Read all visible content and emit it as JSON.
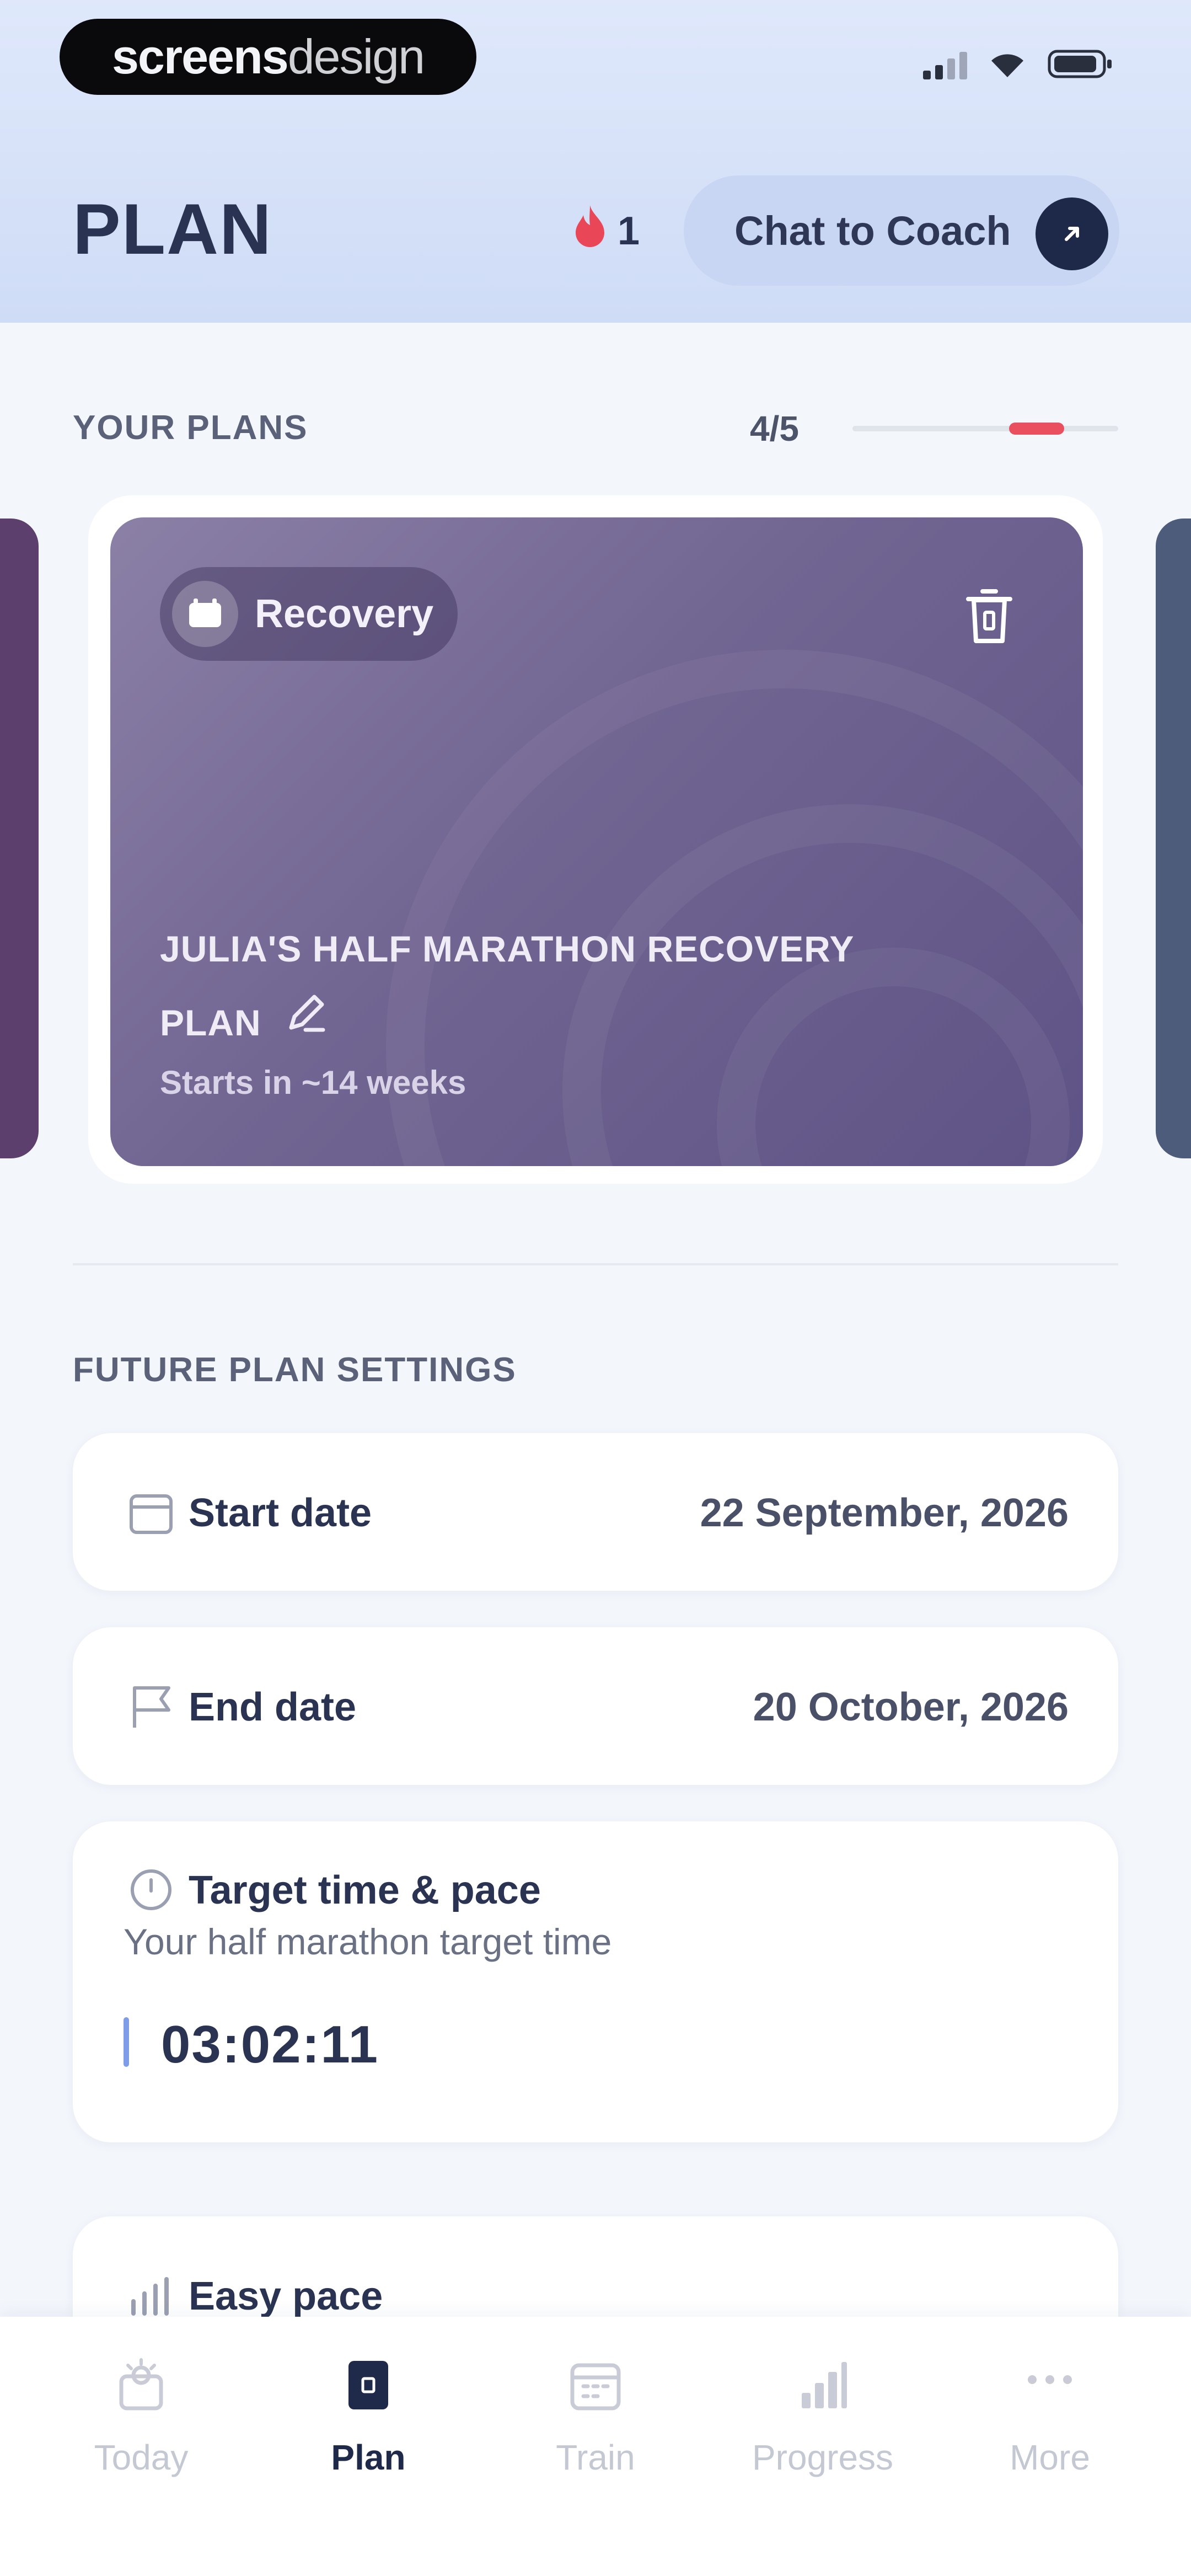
{
  "status_bar": {
    "brand_bold": "screens",
    "brand_light": "design"
  },
  "header": {
    "title": "PLAN",
    "streak_count": "1",
    "coach_button": "Chat to Coach"
  },
  "plans": {
    "section_label": "YOUR PLANS",
    "counter": "4/5",
    "carousel_position_fraction": 0.8,
    "card": {
      "badge": "Recovery",
      "name_line1": "JULIA'S HALF MARATHON RECOVERY",
      "name_line2": "PLAN",
      "start_text": "Starts in ~14 weeks",
      "accent": "#7a6e9c"
    }
  },
  "future_settings": {
    "section_label": "FUTURE PLAN SETTINGS",
    "start_date": {
      "label": "Start date",
      "value": "22 September, 2026"
    },
    "end_date": {
      "label": "End date",
      "value": "20 October, 2026"
    },
    "target": {
      "label": "Target time & pace",
      "subtitle": "Your half marathon target time",
      "value": "03:02:11"
    },
    "easy_pace": {
      "label": "Easy pace"
    }
  },
  "bottom_nav": {
    "items": [
      {
        "label": "Today",
        "icon": "sun-calendar-icon",
        "active": false
      },
      {
        "label": "Plan",
        "icon": "plan-book-icon",
        "active": true
      },
      {
        "label": "Train",
        "icon": "calendar-icon",
        "active": false
      },
      {
        "label": "Progress",
        "icon": "bar-chart-icon",
        "active": false
      },
      {
        "label": "More",
        "icon": "more-dots-icon",
        "active": false
      }
    ]
  },
  "colors": {
    "streak_flame": "#e94658",
    "progress_accent": "#ea4f5f",
    "coach_button_bg": "#c9d6f3",
    "nav_active": "#1f2a4a"
  }
}
